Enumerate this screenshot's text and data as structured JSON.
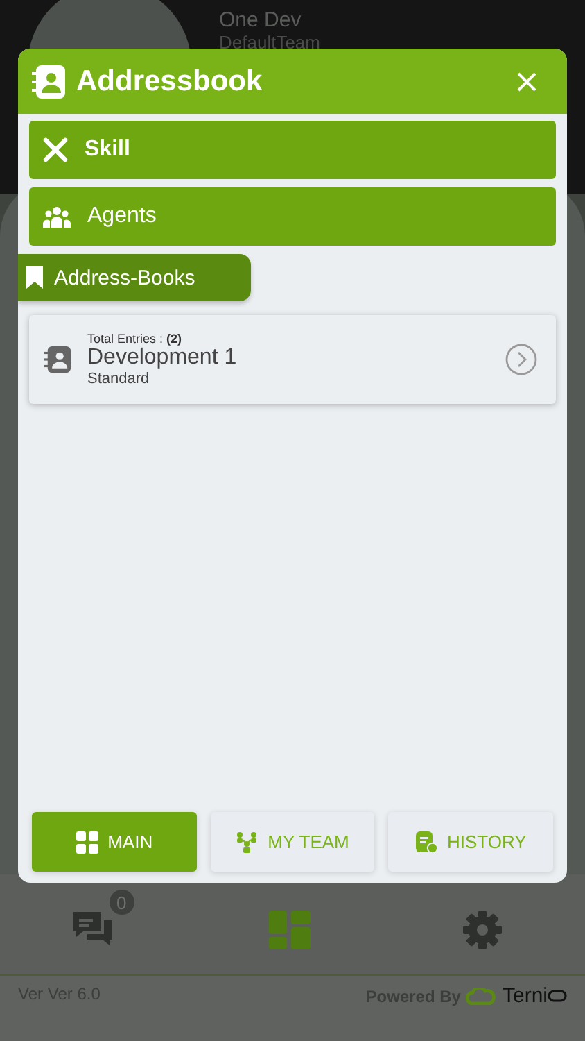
{
  "header": {
    "name": "One Dev",
    "team": "DefaultTeam"
  },
  "modal": {
    "title": "Addressbook",
    "menu": [
      {
        "label": "Skill",
        "kind": "skill"
      },
      {
        "label": "Agents",
        "kind": "agents"
      }
    ],
    "section": {
      "label": "Address-Books"
    },
    "entries": [
      {
        "count_label": "Total Entries : **(2)**",
        "name": "Development 1",
        "type": "Standard"
      }
    ],
    "nav": [
      {
        "label": "MAIN",
        "kind": "main",
        "selected": true
      },
      {
        "label": "MY TEAM",
        "kind": "team",
        "selected": false
      },
      {
        "label": "HISTORY",
        "kind": "history",
        "selected": false
      }
    ]
  },
  "tabbar": [
    {
      "kind": "chat",
      "badge": "0",
      "selected": false
    },
    {
      "kind": "dashboard",
      "selected": true
    },
    {
      "kind": "settings",
      "selected": false
    }
  ],
  "footer": {
    "version": "Ver Ver 6.0",
    "powered_by": "Powered By",
    "brand": "Terni"
  }
}
